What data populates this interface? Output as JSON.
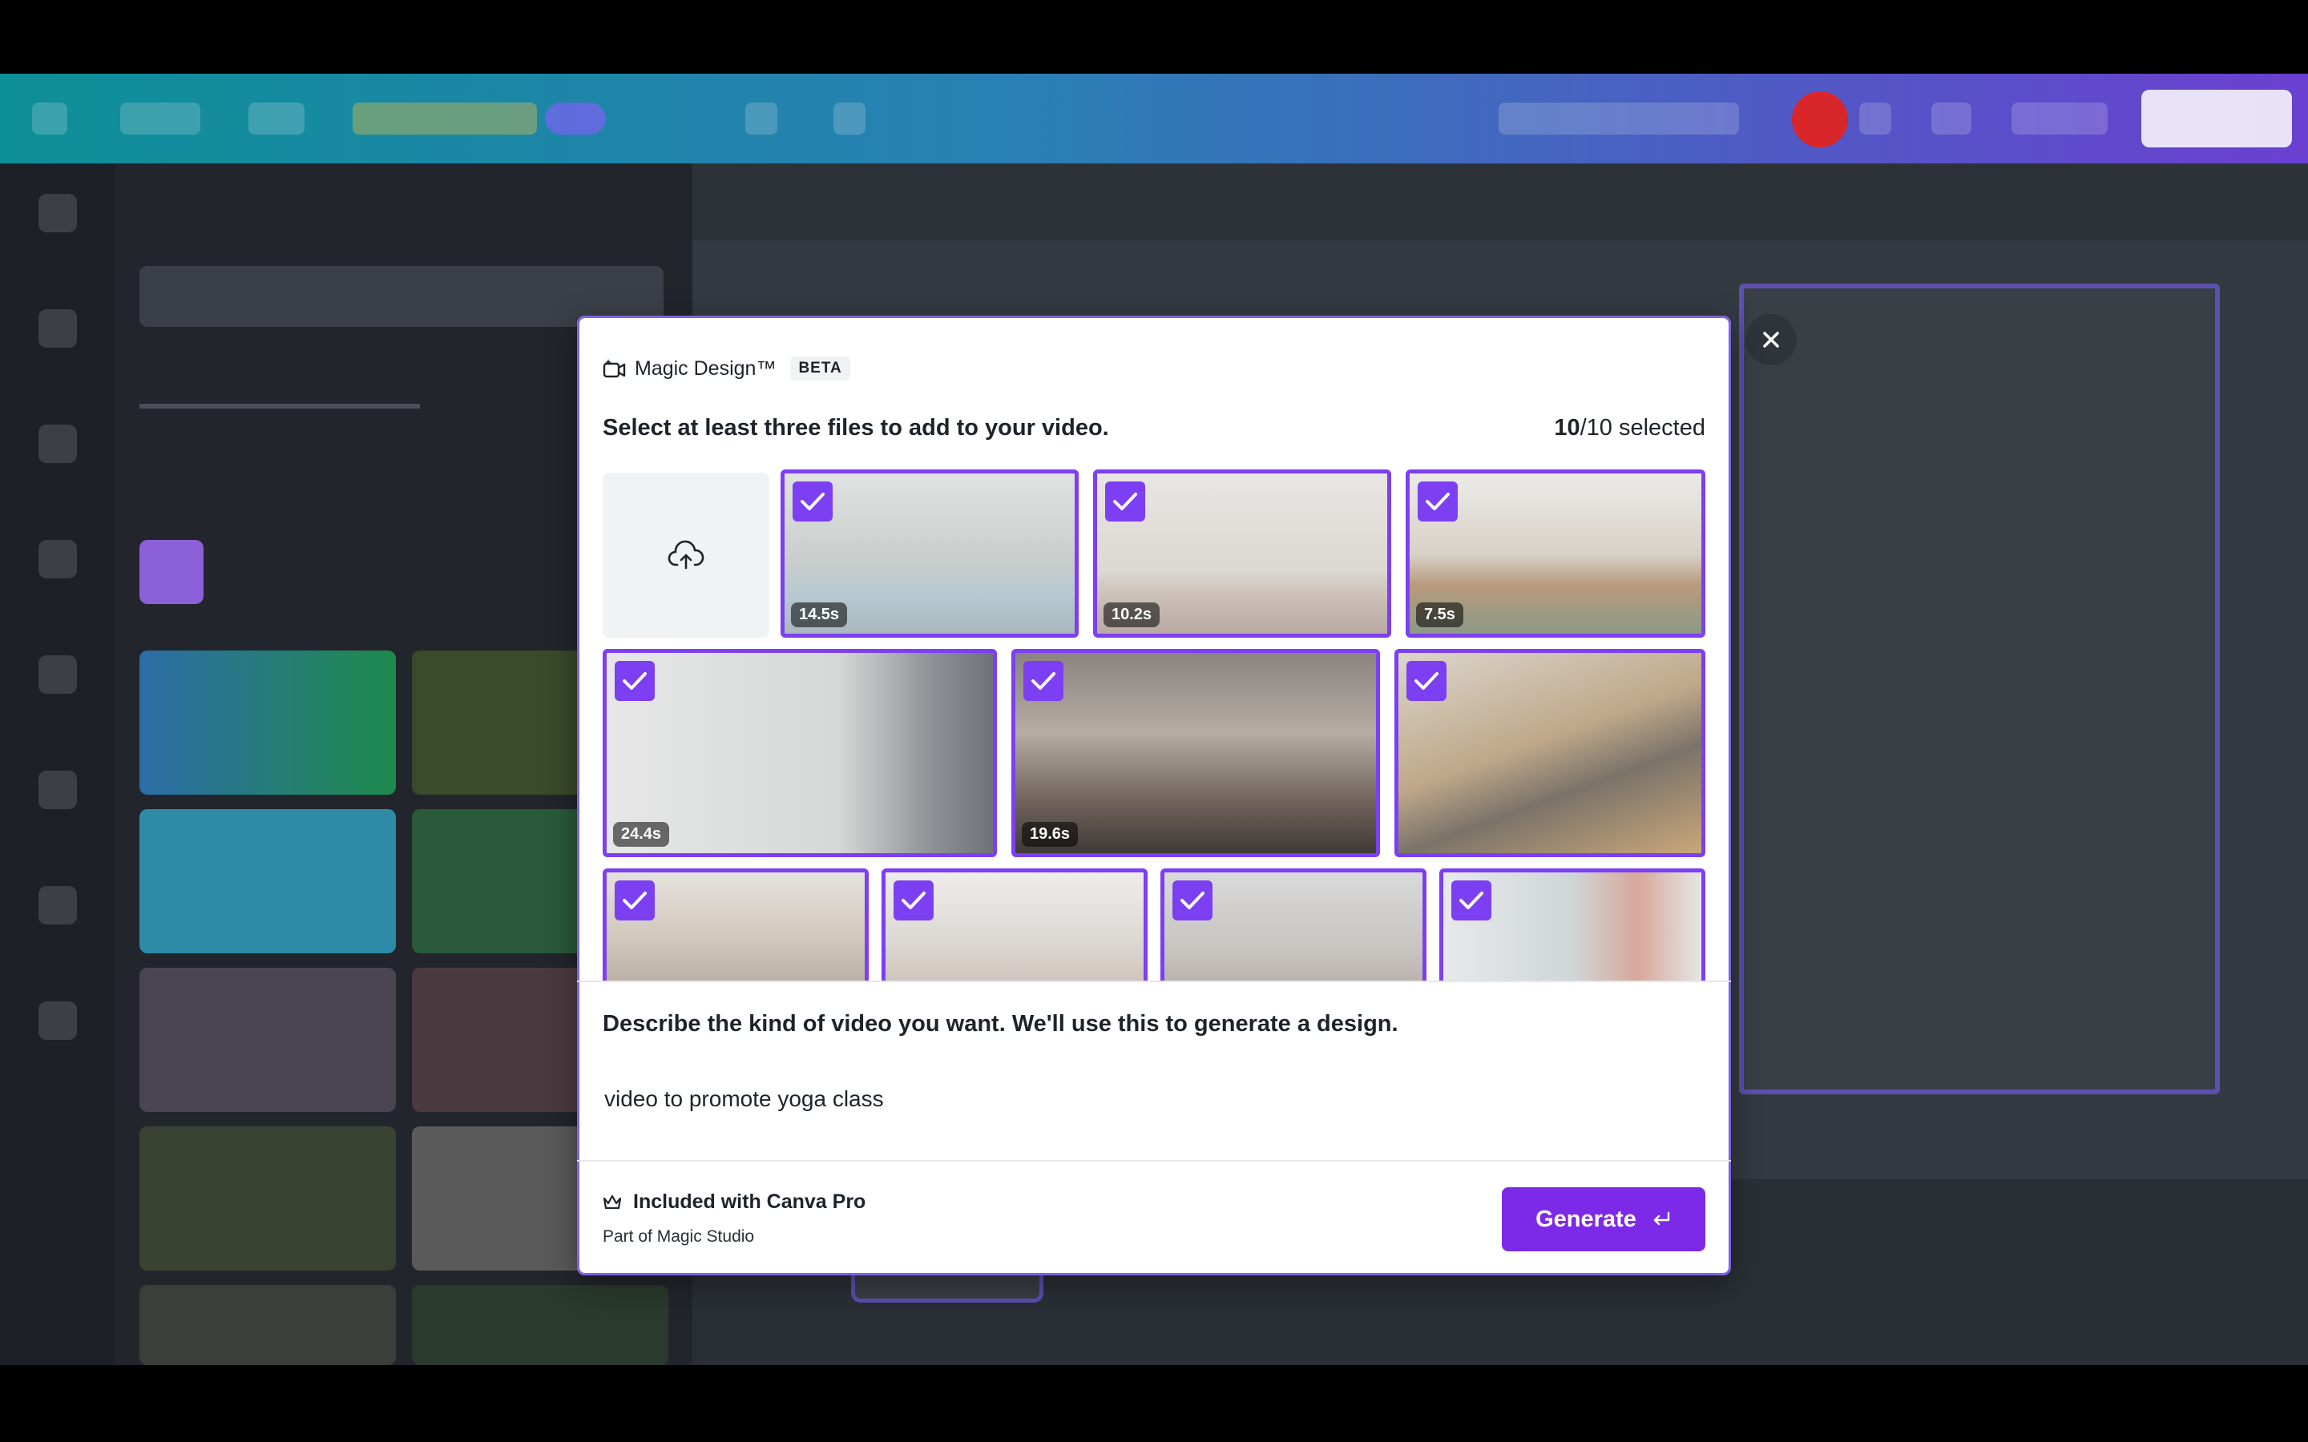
{
  "modal": {
    "title": "Magic Design™",
    "badge": "BETA",
    "instruction": "Select at least three files to add to your video.",
    "selected_count": "10",
    "selected_total": "/10 selected",
    "media": [
      {
        "duration": "14.5s",
        "selected": true
      },
      {
        "duration": "10.2s",
        "selected": true
      },
      {
        "duration": "7.5s",
        "selected": true
      },
      {
        "duration": "24.4s",
        "selected": true
      },
      {
        "duration": "19.6s",
        "selected": true
      },
      {
        "duration": "",
        "selected": true
      },
      {
        "duration": "",
        "selected": true
      },
      {
        "duration": "",
        "selected": true
      },
      {
        "duration": "",
        "selected": true
      },
      {
        "duration": "",
        "selected": true
      }
    ],
    "describe_label": "Describe the kind of video you want. We'll use this to generate a design.",
    "prompt_value": "video to promote yoga class",
    "pro_label": "Included with Canva Pro",
    "studio_label": "Part of Magic Studio",
    "generate_label": "Generate"
  },
  "icons": {
    "upload": "cloud-upload-icon",
    "close": "close-icon",
    "check": "check-icon",
    "crown": "crown-icon",
    "enter": "enter-key-icon",
    "magic": "magic-design-icon"
  },
  "colors": {
    "accent": "#7d2ae8",
    "selection_border": "#7d3ff2"
  }
}
